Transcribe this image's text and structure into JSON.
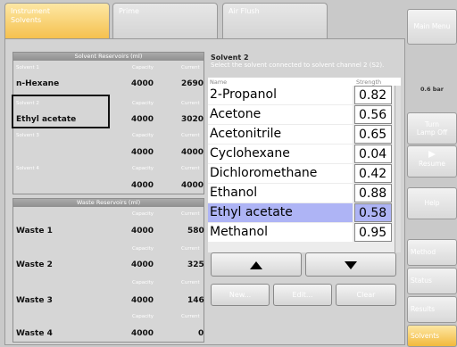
{
  "tabs": [
    {
      "label_line1": "Instrument",
      "label_line2": "Solvents"
    },
    {
      "label_line1": "Prime",
      "label_line2": ""
    },
    {
      "label_line1": "Air Flush",
      "label_line2": ""
    }
  ],
  "solvent_reservoirs": {
    "title": "Solvent Reservoirs (ml)",
    "capacity_header": "Capacity",
    "current_header": "Current",
    "items": [
      {
        "slot": "Solvent 1",
        "name": "n-Hexane",
        "capacity": "4000",
        "current": "2690"
      },
      {
        "slot": "Solvent 2",
        "name": "Ethyl acetate",
        "capacity": "4000",
        "current": "3020"
      },
      {
        "slot": "Solvent 3",
        "name": "",
        "capacity": "4000",
        "current": "4000"
      },
      {
        "slot": "Solvent 4",
        "name": "",
        "capacity": "4000",
        "current": "4000"
      }
    ]
  },
  "waste_reservoirs": {
    "title": "Waste Reservoirs (ml)",
    "capacity_header": "Capacity",
    "current_header": "Current",
    "items": [
      {
        "name": "Waste 1",
        "capacity": "4000",
        "current": "580"
      },
      {
        "name": "Waste 2",
        "capacity": "4000",
        "current": "325"
      },
      {
        "name": "Waste 3",
        "capacity": "4000",
        "current": "146"
      },
      {
        "name": "Waste 4",
        "capacity": "4000",
        "current": "0"
      }
    ]
  },
  "solvent_info": {
    "title": "Solvent 2",
    "description": "Select the solvent connected to solvent channel 2 (S2)."
  },
  "solvent_list": {
    "name_header": "Name",
    "strength_header": "Strength",
    "rows": [
      {
        "name": "2-Propanol",
        "strength": "0.82"
      },
      {
        "name": "Acetone",
        "strength": "0.56"
      },
      {
        "name": "Acetonitrile",
        "strength": "0.65"
      },
      {
        "name": "Cyclohexane",
        "strength": "0.04"
      },
      {
        "name": "Dichloromethane",
        "strength": "0.42"
      },
      {
        "name": "Ethanol",
        "strength": "0.88"
      },
      {
        "name": "Ethyl acetate",
        "strength": "0.58"
      },
      {
        "name": "Methanol",
        "strength": "0.95"
      }
    ]
  },
  "buttons": {
    "new": "New...",
    "edit": "Edit...",
    "clear": "Clear"
  },
  "side_menu": {
    "main_menu": "Main Menu",
    "pressure": "0.6 bar",
    "turn_lamp_line1": "Turn",
    "turn_lamp_line2": "Lamp Off",
    "resume": "Resume",
    "help": "Help",
    "method": "Method",
    "status": "Status",
    "results": "Results",
    "solvents": "Solvents"
  }
}
